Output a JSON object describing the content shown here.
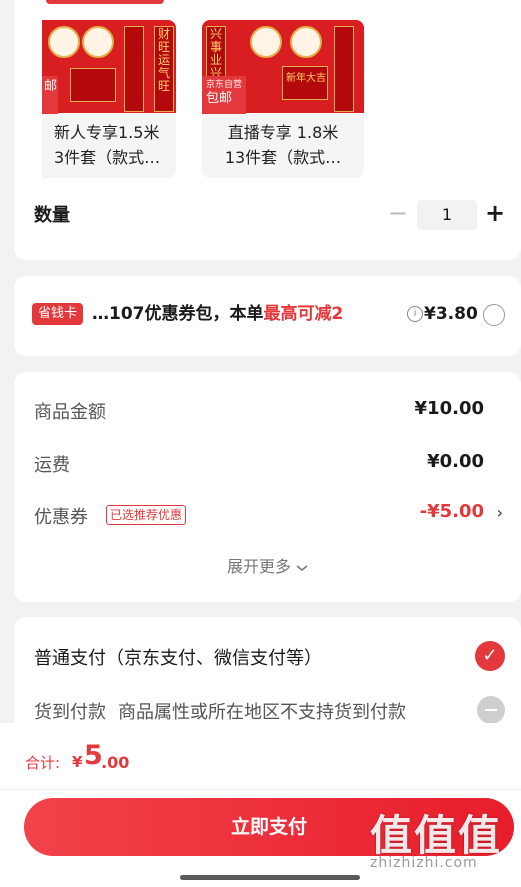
{
  "product": {
    "items": [
      {
        "title_line1": "新人专享1.5米",
        "title_line2": "3件套（款式…",
        "tag_small": "",
        "tag_big": "邮",
        "thumb_text": "财旺运气旺"
      },
      {
        "title_line1": "直播专享 1.8米",
        "title_line2": "13件套（款式…",
        "tag_small": "京东自营",
        "tag_big": "包邮",
        "thumb_text": "兴事业兴",
        "thumb_badge": "新年大吉"
      }
    ],
    "quantity_label": "数量",
    "quantity_minus": "−",
    "quantity_value": "1",
    "quantity_plus": "+"
  },
  "savings": {
    "badge": "省钱卡",
    "text_prefix": "…107优惠券包，本单",
    "text_highlight": "最高可减2",
    "info_icon": "i",
    "amount": "¥3.80"
  },
  "amounts": {
    "goods_label": "商品金额",
    "goods_value": "¥10.00",
    "shipping_label": "运费",
    "shipping_value": "¥0.00",
    "coupon_label": "优惠券",
    "coupon_tag": "已选推荐优惠",
    "coupon_value": "-¥5.00",
    "coupon_chevron": "›",
    "expand_label": "展开更多"
  },
  "payment": {
    "normal_label": "普通支付（京东支付、微信支付等）",
    "cod_label": "货到付款",
    "cod_note": "商品属性或所在地区不支持货到付款"
  },
  "footer": {
    "total_label": "合计:",
    "total_currency": "¥",
    "total_int": "5",
    "total_dec": ".00",
    "pay_button": "立即支付"
  },
  "watermark": {
    "logo": "值值值",
    "url": "zhizhizhi.com"
  },
  "colors": {
    "accent": "#e4393c",
    "background": "#f2f2f2"
  }
}
